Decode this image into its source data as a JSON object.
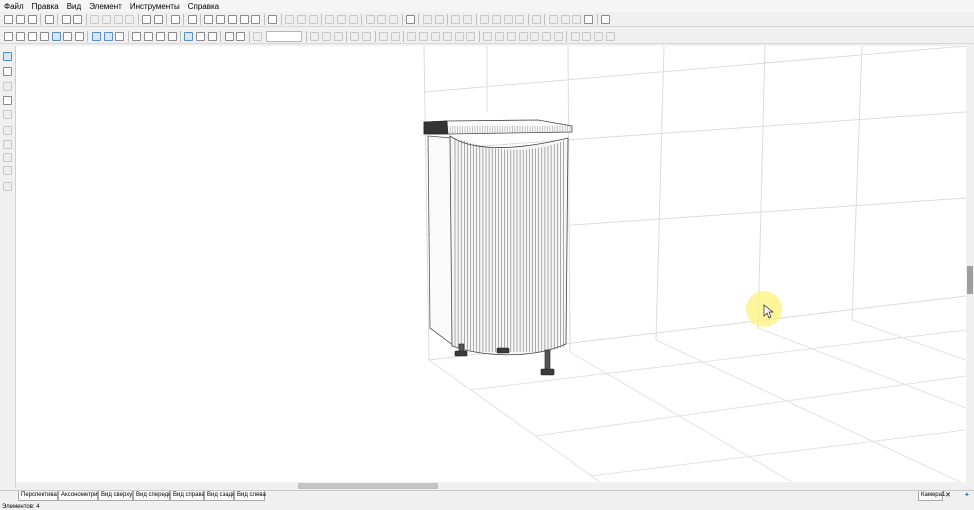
{
  "menu": {
    "items": [
      {
        "label": "Файл"
      },
      {
        "label": "Правка"
      },
      {
        "label": "Вид"
      },
      {
        "label": "Элемент"
      },
      {
        "label": "Инструменты"
      },
      {
        "label": "Справка"
      }
    ]
  },
  "view_tabs": {
    "items": [
      {
        "label": "Перспектива"
      },
      {
        "label": "Аксонометрия"
      },
      {
        "label": "Вид сверху"
      },
      {
        "label": "Вид спереди"
      },
      {
        "label": "Вид справа"
      },
      {
        "label": "Вид сзади"
      },
      {
        "label": "Вид слева"
      }
    ],
    "camera_label": "Камера1"
  },
  "status": {
    "text": "Элементов: 4"
  },
  "scene": {
    "object": "corner-base-cabinet",
    "cursor_highlight_color": "#fff27a"
  }
}
